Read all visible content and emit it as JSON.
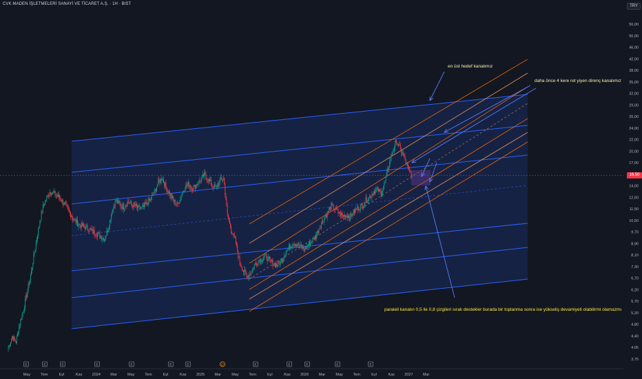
{
  "header": {
    "title": "CVK MADEN İŞLETMELERİ SANAYİ VE TİCARET A.Ş. · 1H · BIST",
    "currency": "TRY",
    "last_price": "16,50"
  },
  "chart_data": {
    "type": "candlestick",
    "y_scale": "log",
    "ylim": [
      3.6,
      60
    ],
    "y_ticks": [
      "56,00",
      "50,00",
      "46,00",
      "42,00",
      "38,00",
      "35,00",
      "32,00",
      "29,00",
      "26,00",
      "24,00",
      "22,00",
      "20,00",
      "17,00",
      "15,50",
      "14,00",
      "12,50",
      "11,50",
      "10,50",
      "9,70",
      "8,90",
      "8,10",
      "7,30",
      "6,70",
      "6,20",
      "5,70",
      "5,20",
      "4,80",
      "4,40",
      "4,05",
      "3,75"
    ],
    "x_ticks": [
      "May",
      "Tem",
      "Eyl",
      "Kas",
      "2024",
      "Mar",
      "May",
      "Tem",
      "Eyl",
      "Kas",
      "2025",
      "Mar",
      "May",
      "Tem",
      "Eyl",
      "Kas",
      "2026",
      "Mar",
      "May",
      "Tem",
      "Eyl",
      "Kas",
      "2027",
      "Mar"
    ],
    "event_markers": [
      {
        "label": "E",
        "type": "earnings"
      },
      {
        "label": "E",
        "type": "earnings"
      },
      {
        "label": "E",
        "type": "earnings"
      },
      {
        "label": "E",
        "type": "earnings"
      },
      {
        "label": "E",
        "type": "earnings"
      },
      {
        "label": "E",
        "type": "earnings"
      },
      {
        "label": "E",
        "type": "earnings"
      },
      {
        "label": "D",
        "type": "dividend"
      },
      {
        "label": "E",
        "type": "earnings"
      },
      {
        "label": "E",
        "type": "earnings"
      },
      {
        "label": "E",
        "type": "earnings"
      },
      {
        "label": "E",
        "type": "earnings"
      },
      {
        "label": "E",
        "type": "earnings"
      }
    ],
    "current_price": 16.5,
    "price_path": [
      4.1,
      4.5,
      4.3,
      5.0,
      5.6,
      6.5,
      7.6,
      9.2,
      11.0,
      12.8,
      13.8,
      14.6,
      14.2,
      13.9,
      13.4,
      12.9,
      12.2,
      11.6,
      11.2,
      11.0,
      10.9,
      10.7,
      10.5,
      10.3,
      10.1,
      9.9,
      10.8,
      12.4,
      13.5,
      13.0,
      12.8,
      13.3,
      13.1,
      12.9,
      12.6,
      12.7,
      13.2,
      13.6,
      14.4,
      15.6,
      16.2,
      15.0,
      14.2,
      13.4,
      13.0,
      14.1,
      15.1,
      15.4,
      14.8,
      15.4,
      15.9,
      16.6,
      16.0,
      15.3,
      14.9,
      15.8,
      16.1,
      11.9,
      10.6,
      9.8,
      8.4,
      7.7,
      7.3,
      7.5,
      8.0,
      8.3,
      8.4,
      8.6,
      8.3,
      8.1,
      8.0,
      8.3,
      8.8,
      9.2,
      9.6,
      9.5,
      9.3,
      9.1,
      9.4,
      9.8,
      10.1,
      10.9,
      11.6,
      12.2,
      12.9,
      12.6,
      12.2,
      11.9,
      12.0,
      11.8,
      12.4,
      12.7,
      12.9,
      13.5,
      13.9,
      14.5,
      14.7,
      14.3,
      15.7,
      17.9,
      20.1,
      21.7,
      20.4,
      19.0,
      17.4,
      16.5
    ],
    "annotations": [
      {
        "text": "en üst hedef kanalımız"
      },
      {
        "text": "daha önce 4 kere ret yiyen direnç kanalımız"
      },
      {
        "text": "paraleli kanalın  0,5 ile 0,8 çizgileri sıralı destekler burada bir toplanma sonra ise yükseliş  devamiyeti olabilirmi olamazmı göre"
      }
    ]
  },
  "colors": {
    "background": "#131722",
    "bull": "#089981",
    "bear": "#f23645",
    "channel_line": "#2962ff",
    "channel_fill": "#1e3a8a",
    "orange_channel": "#ff6d00",
    "price_line": "#f23645",
    "annotation_text": "#fff3b0"
  }
}
